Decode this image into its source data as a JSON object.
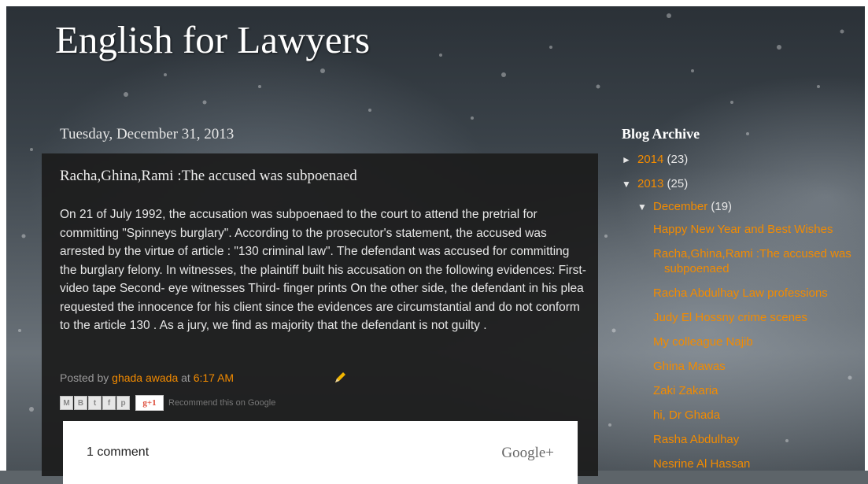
{
  "blog": {
    "title": "English for Lawyers"
  },
  "post": {
    "date": "Tuesday, December 31, 2013",
    "title": "Racha,Ghina,Rami :The accused was subpoenaed",
    "body": "On 21 of July 1992, the accusation was subpoenaed to the court to attend the pretrial for committing \"Spinneys burglary\". According to the prosecutor's statement, the accused was arrested by the virtue of article : \"130 criminal law\". The defendant was accused for committing the burglary felony. In witnesses, the plaintiff built his accusation on the following evidences: First- video tape Second- eye witnesses Third- finger prints On the other side, the defendant in his plea requested the innocence for his client since the evidences are circumstantial and do not conform to the article 130 . As a jury, we find as majority that the defendant is not guilty .",
    "posted_by_label": "Posted by",
    "author": "ghada awada",
    "at_label": "at",
    "time": "6:17 AM",
    "share": {
      "buttons": [
        "M",
        "B",
        "t",
        "f",
        "p"
      ],
      "plus_label": "+1",
      "recommend": "Recommend this on Google"
    },
    "comments": {
      "count_label": "1 comment",
      "provider": "Google+"
    }
  },
  "sidebar": {
    "title": "Blog Archive",
    "years": [
      {
        "toggle": "►",
        "label": "2014",
        "count": "(23)"
      },
      {
        "toggle": "▼",
        "label": "2013",
        "count": "(25)"
      }
    ],
    "month": {
      "toggle": "▼",
      "label": "December",
      "count": "(19)"
    },
    "posts": [
      "Happy New Year and Best Wishes",
      "Racha,Ghina,Rami :The accused was subpoenaed",
      "Racha Abdulhay Law professions",
      "Judy El Hossny crime scenes",
      "My colleague Najib",
      "Ghina Mawas",
      "Zaki Zakaria",
      "hi, Dr Ghada",
      "Rasha Abdulhay",
      "Nesrine Al Hassan"
    ]
  },
  "colors": {
    "link": "#f28b00",
    "post_bg": "#1c1c1c",
    "text": "#e6e6e6"
  }
}
